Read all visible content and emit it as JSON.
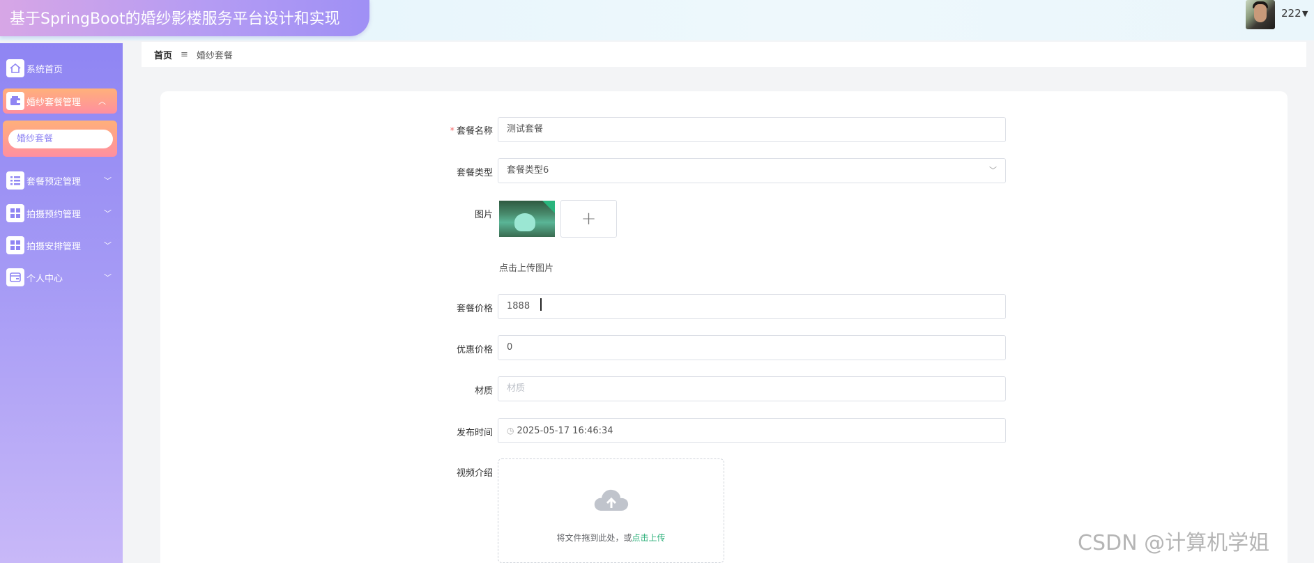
{
  "app": {
    "title": "基于SpringBoot的婚纱影楼服务平台设计和实现",
    "username": "222"
  },
  "sidebar": {
    "items": [
      {
        "label": "系统首页",
        "icon": "home-icon"
      },
      {
        "label": "婚纱套餐管理",
        "icon": "wallet-icon",
        "expanded": true
      },
      {
        "label": "套餐预定管理",
        "icon": "list-icon"
      },
      {
        "label": "拍摄预约管理",
        "icon": "grid-icon"
      },
      {
        "label": "拍摄安排管理",
        "icon": "grid-icon"
      },
      {
        "label": "个人中心",
        "icon": "card-icon"
      }
    ],
    "submenu": {
      "label": "婚纱套餐"
    }
  },
  "breadcrumb": {
    "home": "首页",
    "separator": "≡",
    "current": "婚纱套餐"
  },
  "form": {
    "name": {
      "label": "套餐名称",
      "required": true,
      "value": "测试套餐"
    },
    "type": {
      "label": "套餐类型",
      "value": "套餐类型6"
    },
    "image": {
      "label": "图片",
      "hint": "点击上传图片",
      "plus": "+"
    },
    "price": {
      "label": "套餐价格",
      "value": "1888"
    },
    "discount": {
      "label": "优惠价格",
      "value": "0"
    },
    "material": {
      "label": "材质",
      "placeholder": "材质"
    },
    "publish_time": {
      "label": "发布时间",
      "value": "2025-05-17 16:46:34"
    },
    "video": {
      "label": "视频介绍",
      "drag_text": "将文件拖到此处，或",
      "click_upload": "点击上传"
    }
  },
  "watermark": "CSDN @计算机学姐",
  "colors": {
    "sidebar_top": "#8f85f3",
    "sidebar_bottom": "#c8b8f8",
    "active_item": "#ff9e8c",
    "accent_green": "#2db07a",
    "required_star": "#f56c6c"
  }
}
